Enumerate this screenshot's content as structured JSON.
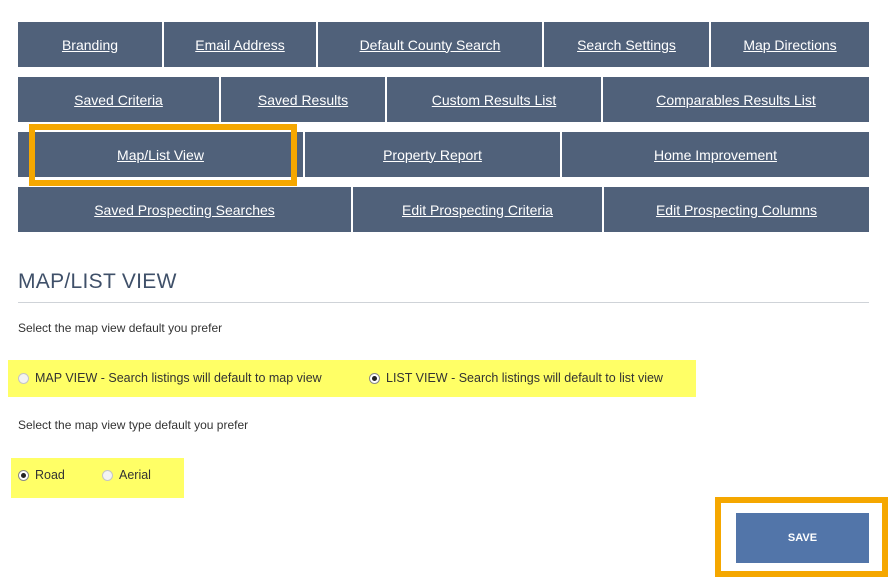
{
  "nav": {
    "row1": [
      "Branding",
      "Email Address",
      "Default County Search",
      "Search Settings",
      "Map Directions"
    ],
    "row2": [
      "Saved Criteria",
      "Saved Results",
      "Custom Results List",
      "Comparables Results List"
    ],
    "row3": [
      "Map/List View",
      "Property Report",
      "Home Improvement"
    ],
    "row4": [
      "Saved Prospecting Searches",
      "Edit Prospecting Criteria",
      "Edit Prospecting Columns"
    ]
  },
  "section": {
    "title": "MAP/LIST VIEW",
    "view_prompt": "Select the map view default you prefer",
    "view_options": [
      {
        "label": "MAP VIEW - Search listings will default to map view",
        "checked": false
      },
      {
        "label": "LIST VIEW - Search listings will default to list view",
        "checked": true
      }
    ],
    "type_prompt": "Select the map view type default you prefer",
    "type_options": [
      {
        "label": "Road",
        "checked": true
      },
      {
        "label": "Aerial",
        "checked": false
      }
    ]
  },
  "save_label": "SAVE",
  "colors": {
    "nav_bg": "#50617a",
    "highlight_orange": "#f5a700",
    "highlight_yellow": "#ffff66",
    "save_bg": "#5275a9"
  }
}
